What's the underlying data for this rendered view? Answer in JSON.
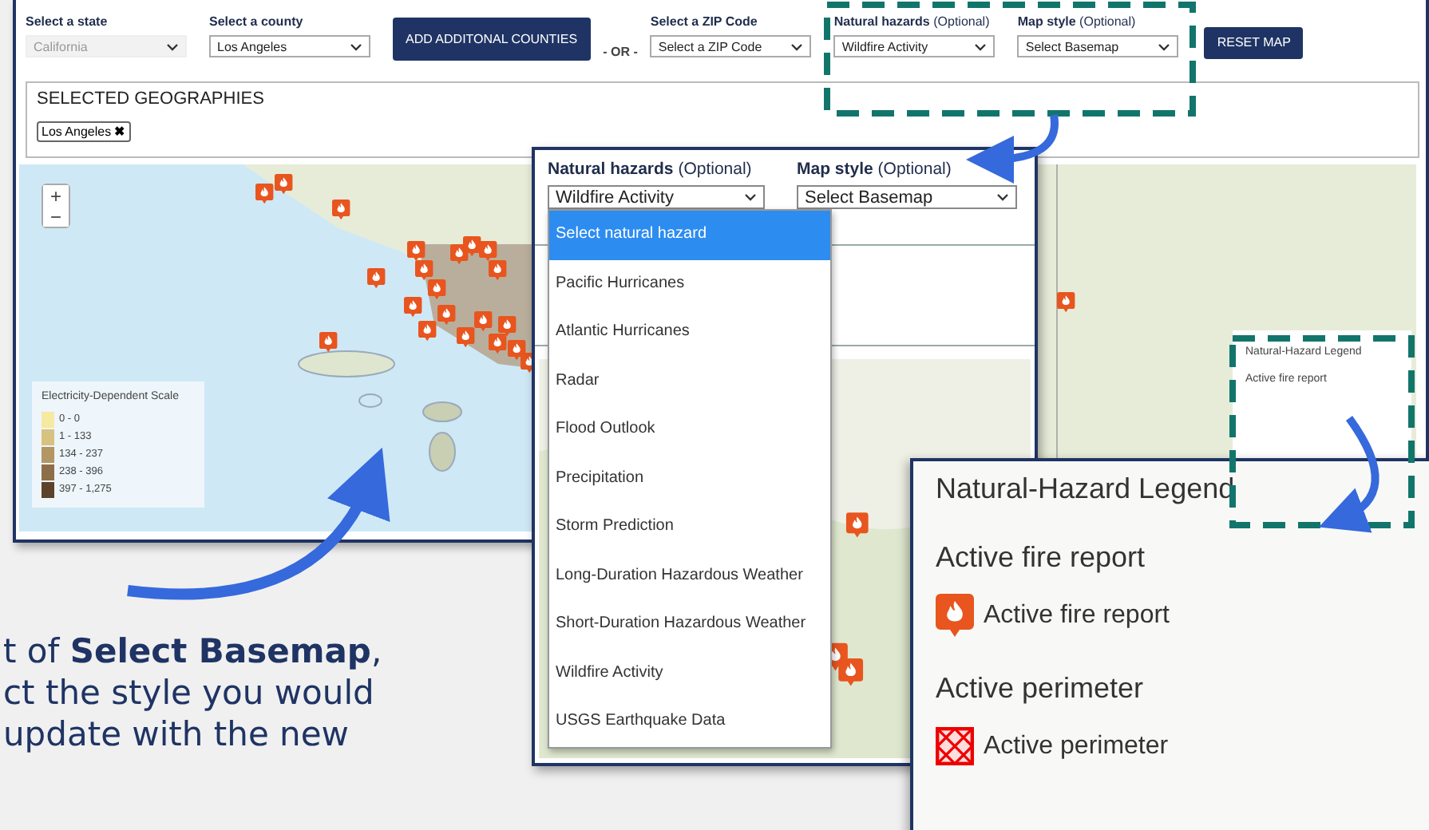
{
  "toolbar": {
    "selects": [
      {
        "kind": "select",
        "label": "Select a state",
        "value": "California",
        "disabled": true
      },
      {
        "kind": "select",
        "label": "Select a county",
        "value": "Los Angeles",
        "disabled": false
      },
      {
        "kind": "button",
        "label": "ADD ADDITONAL COUNTIES"
      },
      {
        "kind": "separator",
        "label": "- OR -"
      },
      {
        "kind": "select",
        "label": "Select a ZIP Code",
        "value": "Select a ZIP Code",
        "disabled": false
      },
      {
        "kind": "select",
        "label": "Natural hazards",
        "hint": "(Optional)",
        "value": "Wildfire Activity",
        "disabled": false
      },
      {
        "kind": "select",
        "label": "Map style",
        "hint": "(Optional)",
        "value": "Select Basemap",
        "disabled": false
      },
      {
        "kind": "button",
        "label": "RESET MAP"
      }
    ]
  },
  "selected_geographies": {
    "title": "SELECTED GEOGRAPHIES",
    "chips": [
      {
        "label": "Los Angeles",
        "remove": "✖"
      }
    ]
  },
  "map": {
    "zoom_in": "+",
    "zoom_out": "−",
    "scale_legend": {
      "title": "Electricity-Dependent Scale",
      "items": [
        {
          "label": "0 - 0",
          "color": "#f6e9a2"
        },
        {
          "label": "1 - 133",
          "color": "#d8c27f"
        },
        {
          "label": "134 - 237",
          "color": "#b39663"
        },
        {
          "label": "238 - 396",
          "color": "#8e6e48"
        },
        {
          "label": "397 - 1,275",
          "color": "#5e4229"
        }
      ]
    },
    "hazard_legend": {
      "title": "Natural-Hazard Legend",
      "heading": "Active fire report"
    }
  },
  "zoom_panel": {
    "hazards": {
      "label": "Natural hazards",
      "hint": "(Optional)",
      "value": "Wildfire Activity"
    },
    "map_style": {
      "label": "Map style",
      "hint": "(Optional)",
      "value": "Select Basemap"
    },
    "options": [
      {
        "label": "Select natural hazard",
        "selected": true
      },
      {
        "label": "Pacific Hurricanes",
        "selected": false
      },
      {
        "label": "Atlantic Hurricanes",
        "selected": false
      },
      {
        "label": "Radar",
        "selected": false
      },
      {
        "label": "Flood Outlook",
        "selected": false
      },
      {
        "label": "Precipitation",
        "selected": false
      },
      {
        "label": "Storm Prediction",
        "selected": false
      },
      {
        "label": "Long-Duration Hazardous Weather",
        "selected": false
      },
      {
        "label": "Short-Duration Hazardous Weather",
        "selected": false
      },
      {
        "label": "Wildfire Activity",
        "selected": false
      },
      {
        "label": "USGS Earthquake Data",
        "selected": false
      }
    ]
  },
  "legend_zoom": {
    "title": "Natural-Hazard Legend",
    "sections": [
      {
        "heading": "Active fire report",
        "item": "Active fire report",
        "kind": "fire"
      },
      {
        "heading": "Active perimeter",
        "item": "Active perimeter",
        "kind": "perimeter"
      }
    ]
  },
  "caption": [
    "t of **Select Basemap**,",
    "ct the style you would",
    "update with the new"
  ]
}
